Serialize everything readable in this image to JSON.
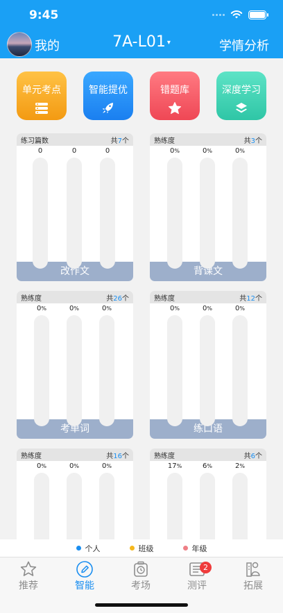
{
  "status": {
    "time": "9:45"
  },
  "header": {
    "me_label": "我的",
    "class_title": "7A-L01",
    "caret": "▾",
    "analysis": "学情分析"
  },
  "tiles": [
    {
      "label": "单元考点",
      "icon": "list-icon"
    },
    {
      "label": "智能提优",
      "icon": "rocket-icon"
    },
    {
      "label": "错题库",
      "icon": "star-icon"
    },
    {
      "label": "深度学习",
      "icon": "layers-icon"
    }
  ],
  "cards": [
    {
      "left_label": "练习篇数",
      "count_prefix": "共",
      "count": "7",
      "count_suffix": "个",
      "values": [
        "0",
        "0",
        "0"
      ],
      "pct": false,
      "footer": "改作文"
    },
    {
      "left_label": "熟练度",
      "count_prefix": "共",
      "count": "3",
      "count_suffix": "个",
      "values": [
        "0",
        "0",
        "0"
      ],
      "pct": true,
      "footer": "背课文"
    },
    {
      "left_label": "熟练度",
      "count_prefix": "共",
      "count": "26",
      "count_suffix": "个",
      "values": [
        "0",
        "0",
        "0"
      ],
      "pct": true,
      "footer": "考单词"
    },
    {
      "left_label": "熟练度",
      "count_prefix": "共",
      "count": "12",
      "count_suffix": "个",
      "values": [
        "0",
        "0",
        "0"
      ],
      "pct": true,
      "footer": "练口语"
    },
    {
      "left_label": "熟练度",
      "count_prefix": "共",
      "count": "16",
      "count_suffix": "个",
      "values": [
        "0",
        "0",
        "0"
      ],
      "pct": true,
      "footer": ""
    },
    {
      "left_label": "熟练度",
      "count_prefix": "共",
      "count": "6",
      "count_suffix": "个",
      "values": [
        "17",
        "6",
        "2"
      ],
      "pct": true,
      "footer": ""
    }
  ],
  "legend": [
    {
      "label": "个人",
      "color": "#1a8ef0"
    },
    {
      "label": "班级",
      "color": "#f6b81e"
    },
    {
      "label": "年级",
      "color": "#ee7f86"
    }
  ],
  "tabs": [
    {
      "label": "推荐",
      "icon": "star-icon"
    },
    {
      "label": "智能",
      "icon": "pencil-icon"
    },
    {
      "label": "考场",
      "icon": "clock-icon"
    },
    {
      "label": "测评",
      "icon": "document-icon",
      "badge": "2"
    },
    {
      "label": "拓展",
      "icon": "person-book-icon"
    }
  ],
  "colors": {
    "primary": "#1aa0f5",
    "footer_bar": "#9dafcb",
    "accent": "#1a8ef0"
  }
}
